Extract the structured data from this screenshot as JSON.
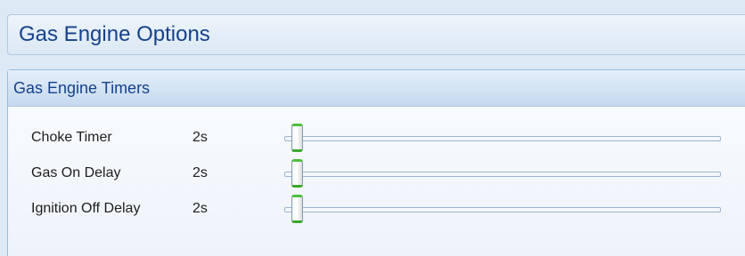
{
  "page": {
    "title": "Gas Engine Options"
  },
  "group": {
    "title": "Gas Engine Timers",
    "rows": [
      {
        "label": "Choke Timer",
        "value": "2s",
        "slider_fraction": 0.0
      },
      {
        "label": "Gas On Delay",
        "value": "2s",
        "slider_fraction": 0.0
      },
      {
        "label": "Ignition Off Delay",
        "value": "2s",
        "slider_fraction": 0.0
      }
    ]
  },
  "colors": {
    "title_text": "#15428b",
    "thumb_accent": "#4fbf3c",
    "track_border": "#9db5d0"
  }
}
